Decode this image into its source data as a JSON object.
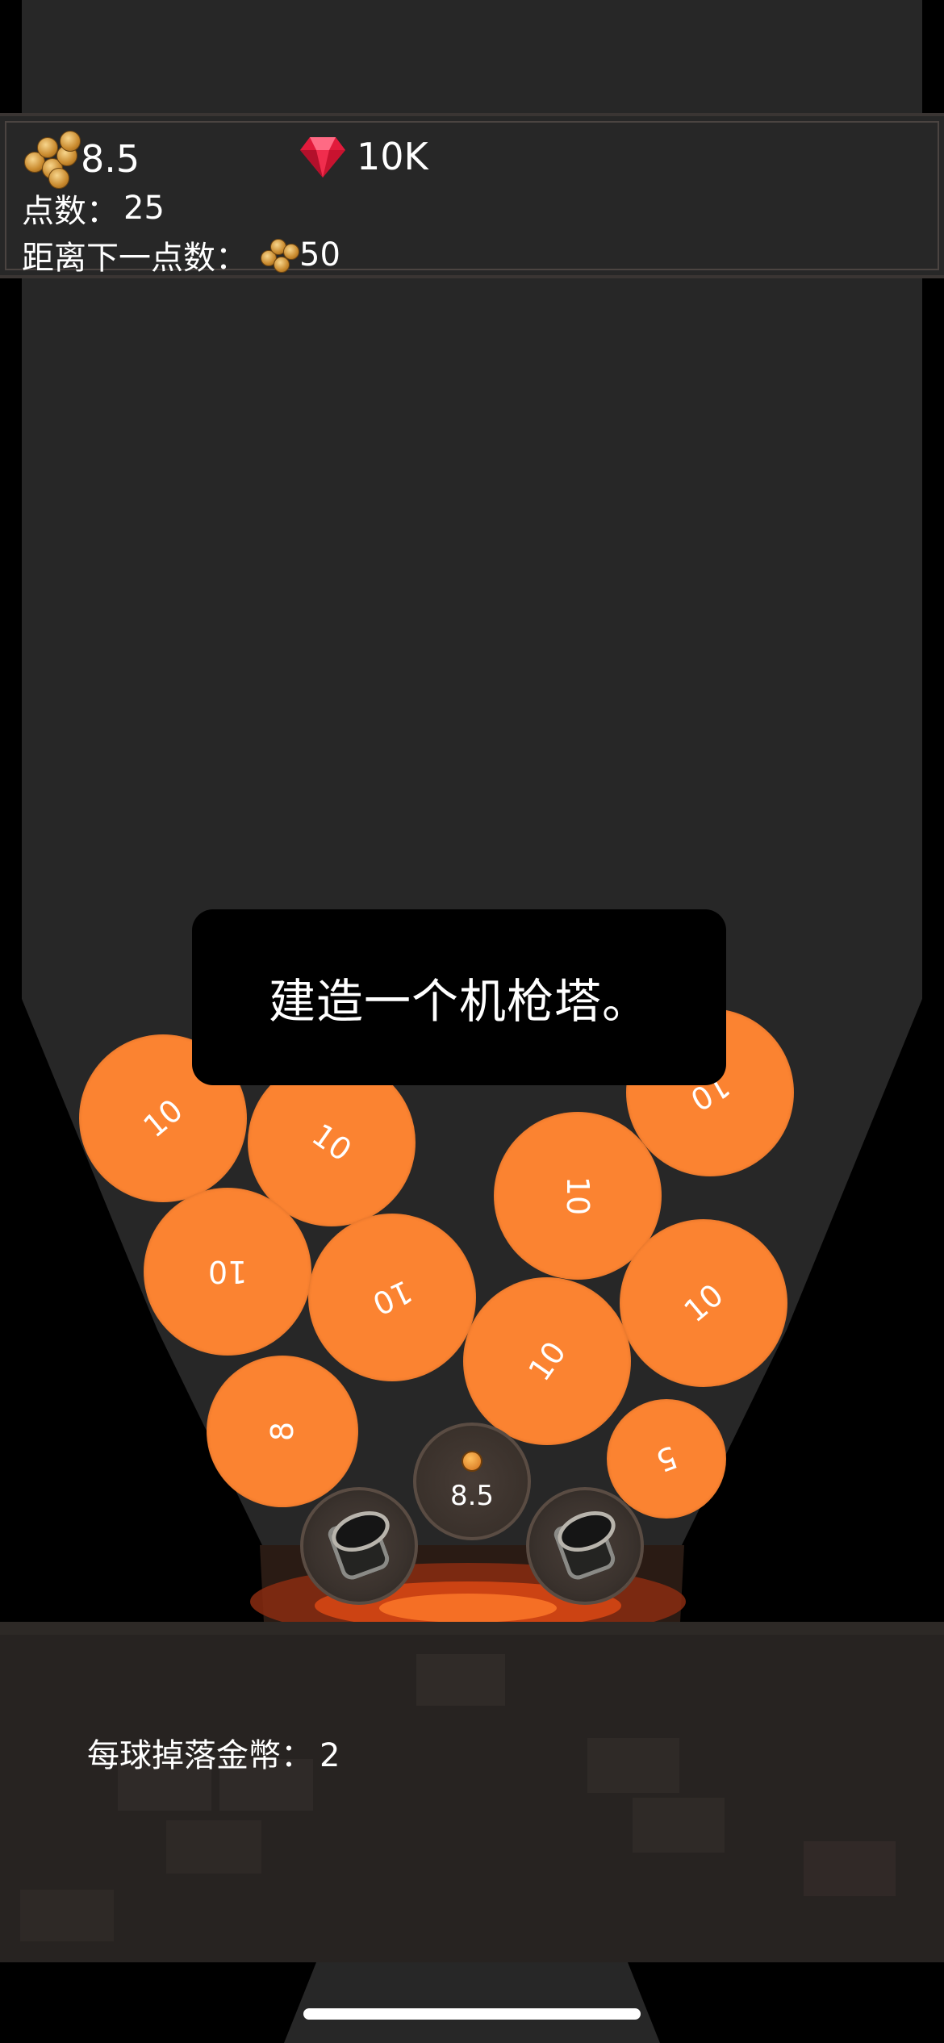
{
  "hud": {
    "coins": "8.5",
    "gems": "10K",
    "points_label": "点数：",
    "points_value": "25",
    "next_point_label": "距离下一点数：",
    "next_point_value": "50"
  },
  "tooltip": {
    "text": "建造一个机枪塔。"
  },
  "balls": [
    {
      "value": "10"
    },
    {
      "value": "10"
    },
    {
      "value": "10"
    },
    {
      "value": "10"
    },
    {
      "value": "10"
    },
    {
      "value": "10"
    },
    {
      "value": "10"
    },
    {
      "value": "10"
    },
    {
      "value": "10"
    },
    {
      "value": "8"
    },
    {
      "value": "5"
    }
  ],
  "center_slot": {
    "value": "8.5"
  },
  "footer": {
    "drop_label": "每球掉落金幣：",
    "drop_value": "2"
  },
  "icons": {
    "coin": "coin-stack-icon",
    "gem": "red-gem-icon",
    "turret": "cannon-turret-icon"
  },
  "colors": {
    "ball": "#fb8331",
    "background": "#272727",
    "panel": "#272321"
  }
}
